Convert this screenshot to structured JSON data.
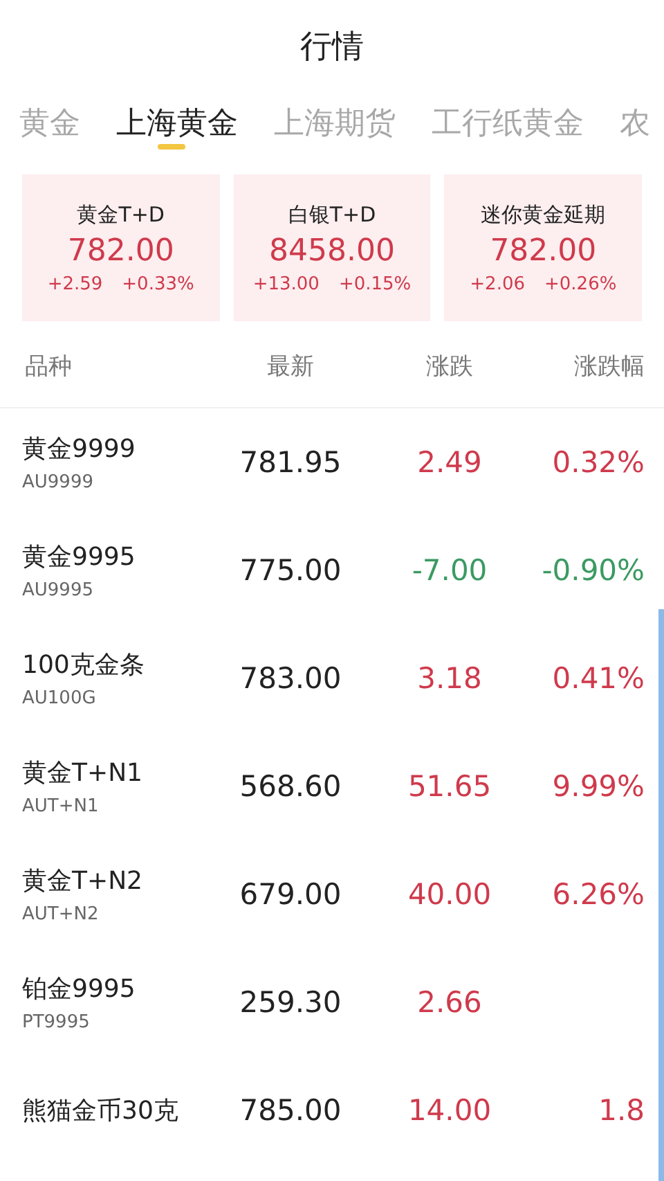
{
  "header": {
    "title": "行情"
  },
  "tabs": [
    {
      "label": "黄金",
      "selected": false
    },
    {
      "label": "上海黄金",
      "selected": true
    },
    {
      "label": "上海期货",
      "selected": false
    },
    {
      "label": "工行纸黄金",
      "selected": false
    },
    {
      "label": "农",
      "selected": false
    }
  ],
  "cards": [
    {
      "name": "黄金T+D",
      "price": "782.00",
      "change": "+2.59",
      "percent": "+0.33%",
      "falling": false
    },
    {
      "name": "白银T+D",
      "price": "8458.00",
      "change": "+13.00",
      "percent": "+0.15%",
      "falling": false
    },
    {
      "name": "迷你黄金延期",
      "price": "782.00",
      "change": "+2.06",
      "percent": "+0.26%",
      "falling": false
    }
  ],
  "table": {
    "columns": [
      "品种",
      "最新",
      "涨跌",
      "涨跌幅"
    ],
    "rows": [
      {
        "name": "黄金9999",
        "code": "AU9999",
        "price": "781.95",
        "change": "2.49",
        "percent": "0.32%",
        "falling": false
      },
      {
        "name": "黄金9995",
        "code": "AU9995",
        "price": "775.00",
        "change": "-7.00",
        "percent": "-0.90%",
        "falling": true
      },
      {
        "name": "100克金条",
        "code": "AU100G",
        "price": "783.00",
        "change": "3.18",
        "percent": "0.41%",
        "falling": false
      },
      {
        "name": "黄金T+N1",
        "code": "AUT+N1",
        "price": "568.60",
        "change": "51.65",
        "percent": "9.99%",
        "falling": false
      },
      {
        "name": "黄金T+N2",
        "code": "AUT+N2",
        "price": "679.00",
        "change": "40.00",
        "percent": "6.26%",
        "falling": false
      },
      {
        "name": "铂金9995",
        "code": "PT9995",
        "price": "259.30",
        "change": "2.66",
        "falling": false
      },
      {
        "name": "熊猫金币30克",
        "price": "785.00",
        "change": "14.00",
        "percent": "1.8",
        "falling": false
      }
    ]
  }
}
